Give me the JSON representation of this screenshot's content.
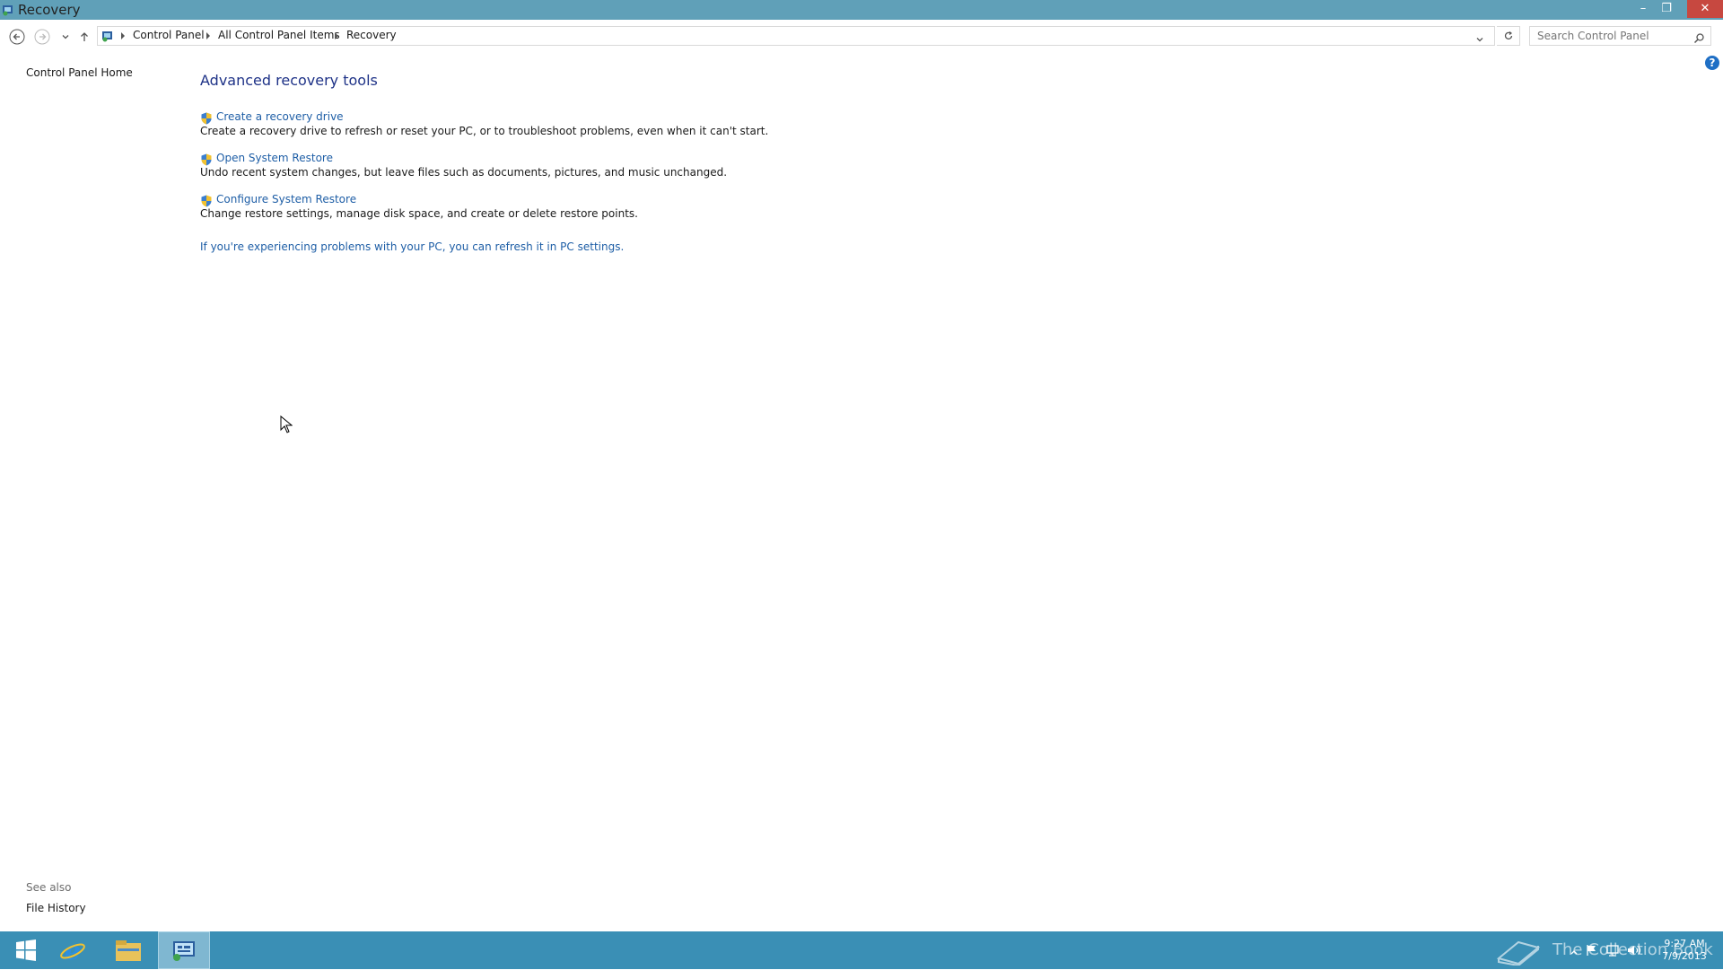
{
  "window": {
    "title": "Recovery",
    "minimize_glyph": "–",
    "restore_glyph": "❐",
    "close_glyph": "✕"
  },
  "address_bar": {
    "breadcrumbs": [
      "Control Panel",
      "All Control Panel Items",
      "Recovery"
    ],
    "search_placeholder": "Search Control Panel"
  },
  "left_pane": {
    "home_link": "Control Panel Home",
    "see_also_label": "See also",
    "see_also_links": [
      "File History"
    ]
  },
  "main": {
    "heading": "Advanced recovery tools",
    "tools": [
      {
        "link": "Create a recovery drive",
        "description": "Create a recovery drive to refresh or reset your PC, or to troubleshoot problems, even when it can't start."
      },
      {
        "link": "Open System Restore",
        "description": "Undo recent system changes, but leave files such as documents, pictures, and music unchanged."
      },
      {
        "link": "Configure System Restore",
        "description": "Change restore settings, manage disk space, and create or delete restore points."
      }
    ],
    "refresh_link": "If you're experiencing problems with your PC, you can refresh it in PC settings."
  },
  "help_glyph": "?",
  "taskbar": {
    "watermark": "The Collection Book",
    "clock_time": "9:27 AM",
    "clock_date": "7/9/2013"
  },
  "colors": {
    "titlebar": "#60a0b8",
    "taskbar": "#3a8fb5",
    "link": "#1e5ea6",
    "heading": "#1e3287"
  }
}
